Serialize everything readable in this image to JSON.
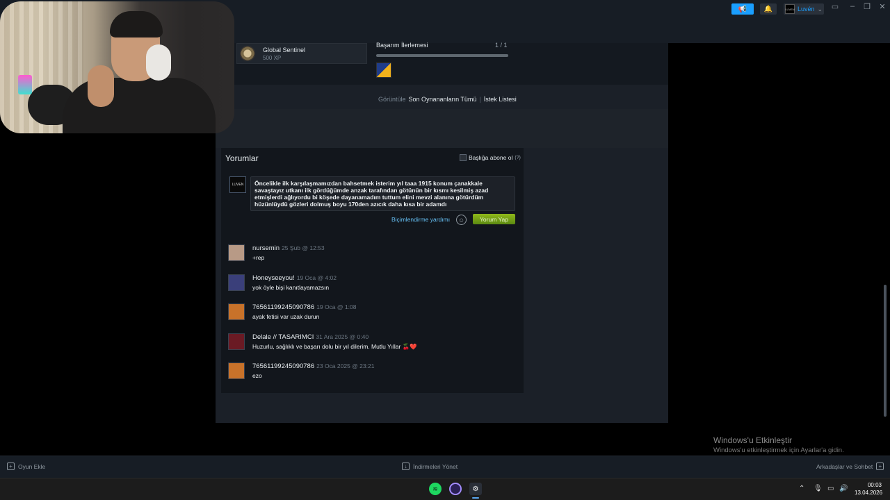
{
  "titlebar": {
    "username": "Luvén",
    "user_avatar_text": "LUVEN"
  },
  "achievement": {
    "title": "Global Sentinel",
    "xp": "500 XP",
    "progress_label": "Başarım İlerlemesi",
    "progress_count": "1 / 1",
    "progress_fraction": 1.0
  },
  "view_links": {
    "prefix": "Görüntüle",
    "recent": "Son Oynananların Tümü",
    "separator": "|",
    "wishlist": "İstek Listesi"
  },
  "comments_panel": {
    "title": "Yorumlar",
    "subscribe_label": "Başlığa abone ol",
    "subscribe_help": "(?)",
    "my_avatar_text": "LUVEN",
    "draft_text": "Öncelikle ilk karşılaşmamızdan bahsetmek isterim yıl taaa 1915 konum çanakkale savaştayız utkanı ilk gördüğümde anzak tarafından götünün bir kısmı kesilmiş azad etmişlerdi ağlıyordu bi köşede dayanamadım tuttum elini mevzi alanına götürdüm hüzünlüydü gözleri dolmuş boyu 170den azıcık daha kısa bir adamdı",
    "formatting_help": "Biçimlendirme yardımı",
    "post_button": "Yorum Yap"
  },
  "comments": [
    {
      "author": "nursemin",
      "date": "25 Şub @ 12:53",
      "text": "+rep",
      "avatar_color": "#b89a86"
    },
    {
      "author": "Honeyseeyou!",
      "date": "19 Oca @ 4:02",
      "text": "yok öyle bişi kanıtlayamazsın",
      "avatar_color": "#3a3f7a"
    },
    {
      "author": "76561199245090786",
      "date": "19 Oca @ 1:08",
      "text": "ayak fetisi var uzak durun",
      "avatar_color": "#c8722a"
    },
    {
      "author": "Delale // TASARIMCI",
      "date": "31 Ara 2025 @ 0:40",
      "text": "Huzurlu, sağlıklı ve başarı dolu bir yıl dilerim. Mutlu Yıllar 🍒❤️",
      "avatar_color": "#6a1a24"
    },
    {
      "author": "76561199245090786",
      "date": "23 Oca 2025 @ 23:21",
      "text": "ezo",
      "avatar_color": "#c8722a"
    }
  ],
  "watermark": {
    "title": "Windows'u Etkinleştir",
    "subtitle": "Windows'u etkinleştirmek için Ayarlar'a gidin."
  },
  "steam_bottom": {
    "add_game": "Oyun Ekle",
    "downloads": "İndirmeleri Yönet",
    "friends": "Arkadaşlar ve Sohbet"
  },
  "taskbar": {
    "time": "00:03",
    "date": "13.04.2026"
  },
  "colors": {
    "accent_blue": "#1a9fff",
    "post_green": "#6a9c14",
    "link_blue": "#66c0f4"
  }
}
